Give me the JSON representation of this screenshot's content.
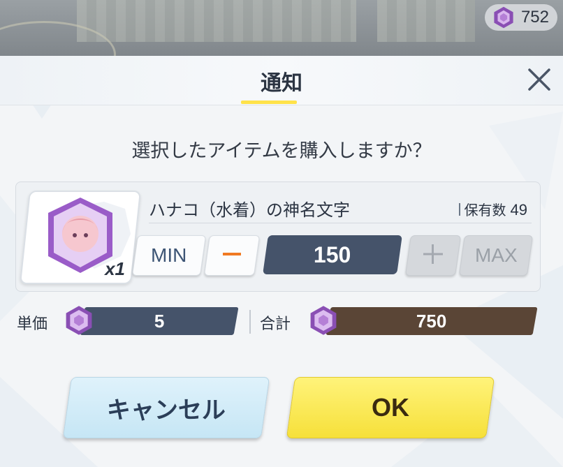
{
  "hud": {
    "currency_value": "752",
    "currency_icon": "pyroxene-gem-icon"
  },
  "dialog": {
    "title": "通知",
    "close_icon": "close-icon",
    "question": "選択したアイテムを購入しますか？",
    "item": {
      "name": "ハナコ（水着）の神名文字",
      "quantity_badge": "x1",
      "owned_label": "保有数",
      "owned_value": "49"
    },
    "controls": {
      "min_label": "MIN",
      "minus_icon": "minus-icon",
      "quantity": "150",
      "plus_icon": "plus-icon",
      "max_label": "MAX"
    },
    "price": {
      "unit_label": "単価",
      "unit_value": "5",
      "total_label": "合計",
      "total_value": "750"
    },
    "buttons": {
      "cancel_label": "キャンセル",
      "ok_label": "OK"
    }
  },
  "colors": {
    "accent_yellow": "#ffe24a",
    "field_navy": "#45536a",
    "total_brown": "#5a4536",
    "minus_orange": "#f07a22"
  }
}
